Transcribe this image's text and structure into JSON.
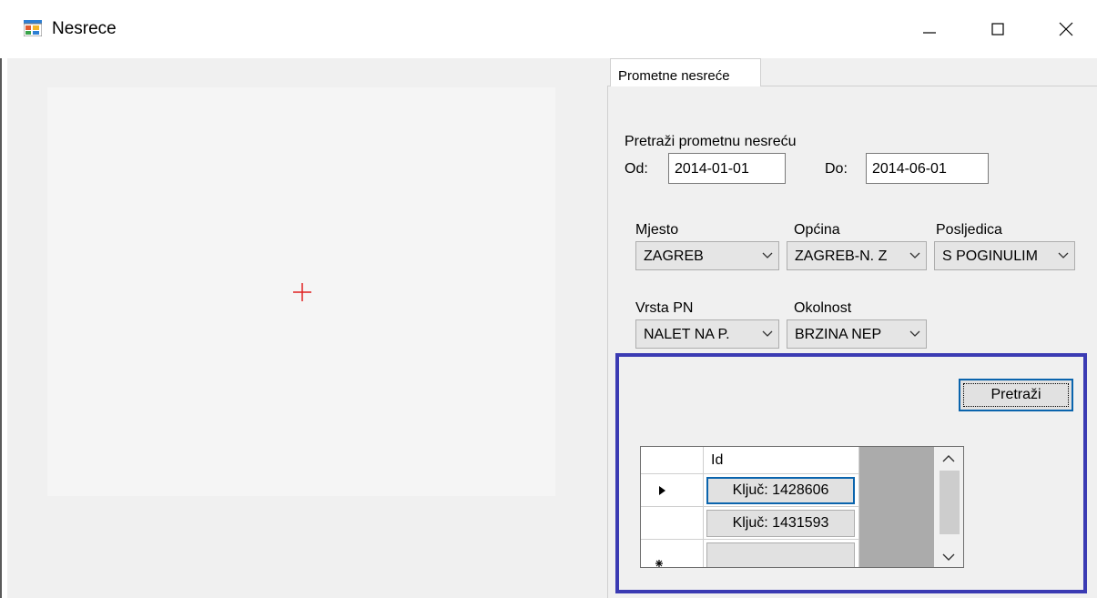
{
  "window": {
    "title": "Nesrece"
  },
  "colors": {
    "highlight_border": "#3b3bb3",
    "focus_blue": "#0a64ad",
    "map_cross": "#e02020"
  },
  "tabs": [
    {
      "label": "Prometne nesreće"
    }
  ],
  "search": {
    "heading": "Pretraži prometnu nesreću",
    "from_label": "Od:",
    "from_value": "2014-01-01",
    "to_label": "Do:",
    "to_value": "2014-06-01",
    "mjesto": {
      "label": "Mjesto",
      "value": "ZAGREB"
    },
    "opcina": {
      "label": "Općina",
      "value": "ZAGREB-N. Z"
    },
    "posljedica": {
      "label": "Posljedica",
      "value": "S POGINULIM"
    },
    "vrsta_pn": {
      "label": "Vrsta PN",
      "value": "NALET NA P."
    },
    "okolnost": {
      "label": "Okolnost",
      "value": "BRZINA NEP"
    },
    "button_label": "Pretraži"
  },
  "grid": {
    "column_header": "Id",
    "rows": [
      {
        "value": "Ključ: 1428606",
        "current": true
      },
      {
        "value": "Ključ: 1431593",
        "current": false
      },
      {
        "value": "",
        "current": false
      }
    ]
  },
  "icons": {
    "app": "windows-form-icon",
    "minimize": "minimize-icon",
    "maximize": "maximize-icon",
    "close": "close-icon",
    "dropdown": "chevron-down-icon",
    "row_current": "row-pointer-icon",
    "row_new": "new-row-icon"
  }
}
